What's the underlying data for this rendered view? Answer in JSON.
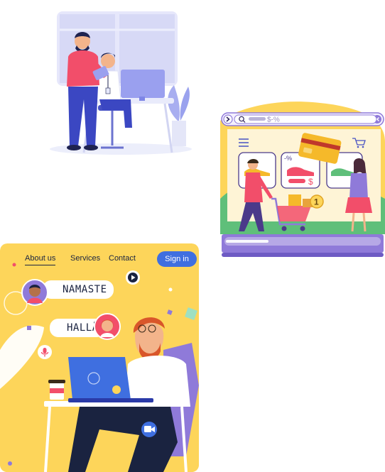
{
  "shop": {
    "search_text": "$-%",
    "quantity_badge": "1",
    "price_symbol": "$",
    "discount_label": "-%"
  },
  "chat_card": {
    "nav": {
      "about": "About us",
      "services": "Services",
      "contact": "Contact",
      "signin": "Sign in"
    },
    "greeting_1": "NAMASTE",
    "greeting_2": "HALLÅ"
  },
  "colors": {
    "yellow_bg": "#fdd55a",
    "brand_blue": "#3f6fe0",
    "purple": "#8f7ad9",
    "coral": "#f24e6a"
  }
}
